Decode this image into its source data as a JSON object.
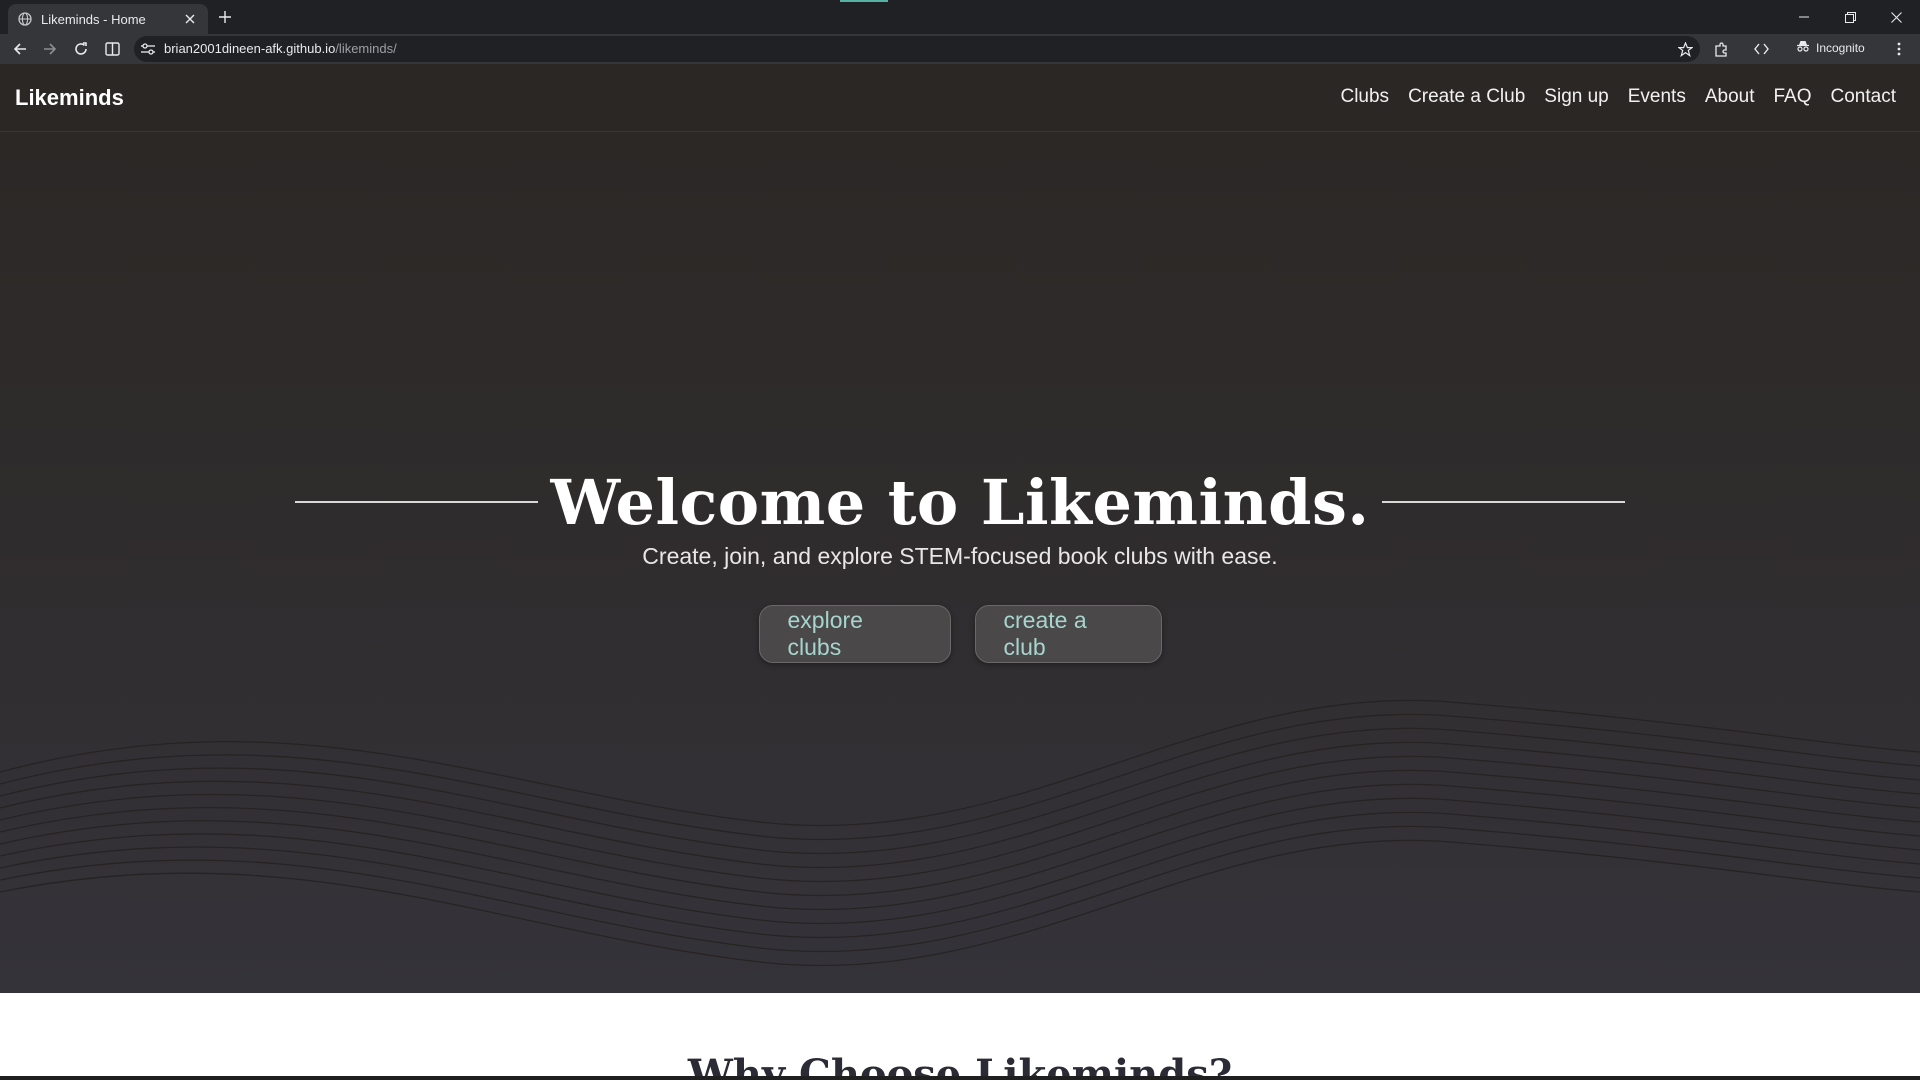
{
  "browser": {
    "tab_title": "Likeminds - Home",
    "url_host": "brian2001dineen-afk.github.io",
    "url_path": "/likeminds/",
    "incognito_label": "Incognito",
    "icons": [
      "globe-icon",
      "close-icon",
      "plus-icon",
      "back-icon",
      "forward-icon",
      "reload-icon",
      "reader-icon",
      "site-settings-icon",
      "star-icon",
      "extensions-icon",
      "devtools-icon",
      "incognito-icon",
      "more-icon",
      "minimize-icon",
      "restore-icon",
      "window-close-icon"
    ]
  },
  "header": {
    "brand": "Likeminds",
    "nav": [
      {
        "label": "Clubs"
      },
      {
        "label": "Create a Club"
      },
      {
        "label": "Sign up"
      },
      {
        "label": "Events"
      },
      {
        "label": "About"
      },
      {
        "label": "FAQ"
      },
      {
        "label": "Contact"
      }
    ]
  },
  "hero": {
    "title": "Welcome to Likeminds.",
    "subtitle": "Create, join, and explore STEM-focused book clubs with ease.",
    "explore_label": "explore clubs",
    "create_label": "create a club"
  },
  "why": {
    "title": "Why Choose Likeminds?"
  },
  "colors": {
    "header_bg": "#2b2725",
    "hero_bg": "#2f2c2d",
    "button_text": "#a7d5cd",
    "accent": "#58b2a4"
  }
}
